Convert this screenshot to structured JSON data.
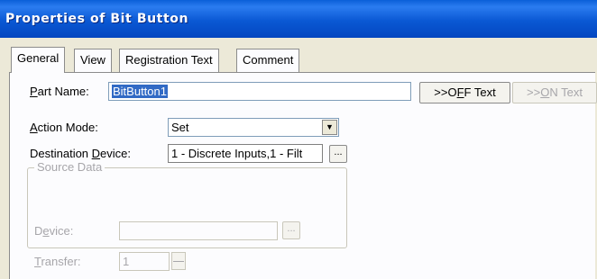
{
  "window": {
    "title": "Properties of Bit Button"
  },
  "tabs": [
    "General",
    "View",
    "Registration Text",
    "Comment"
  ],
  "part_name": {
    "label_accel": "P",
    "label_rest": "art Name:",
    "value": "BitButton1"
  },
  "off_text_button": {
    "prefix": ">>O",
    "accel": "F",
    "rest": "F Text"
  },
  "on_text_button": {
    "prefix": ">>",
    "accel": "O",
    "rest": "N Text"
  },
  "action_mode": {
    "label_accel": "A",
    "label_rest": "ction Mode:",
    "value": "Set"
  },
  "destination_device": {
    "label_pre": "Destination ",
    "label_accel": "D",
    "label_rest": "evice:",
    "value": "1 - Discrete Inputs,1 - Filt",
    "browse": "..."
  },
  "source_data": {
    "legend": "Source Data",
    "device": {
      "label_pre": "D",
      "label_accel": "e",
      "label_rest": "vice:",
      "value": "",
      "browse": "..."
    },
    "transfer": {
      "label_accel": "T",
      "label_rest": "ransfer:",
      "value": "1"
    }
  }
}
